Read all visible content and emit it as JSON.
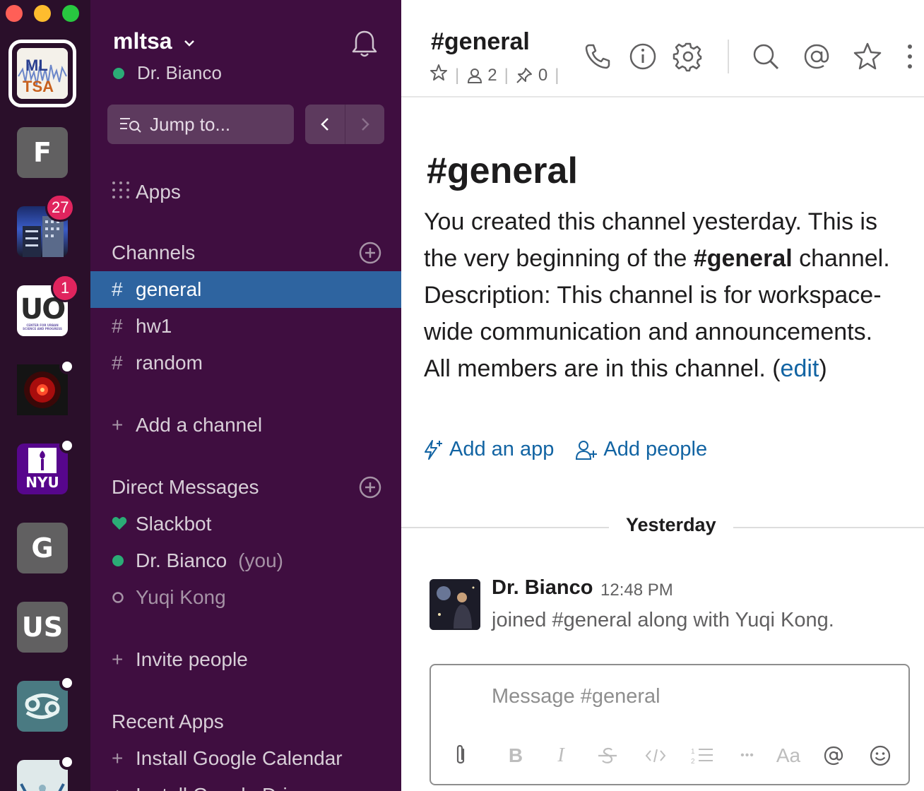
{
  "workspaces": [
    {
      "label": "ML TSA"
    },
    {
      "label": "F"
    },
    {
      "label": "",
      "badge": "27"
    },
    {
      "label": "UO",
      "badge": "1",
      "sublabel": "CENTER FOR URBAN SCIENCE AND PROGRESS"
    },
    {
      "label": ""
    },
    {
      "label": "NYU"
    },
    {
      "label": "G"
    },
    {
      "label": "US"
    },
    {
      "label": ""
    },
    {
      "label": ""
    }
  ],
  "sidebar": {
    "team_name": "mltsa",
    "user_name": "Dr. Bianco",
    "jump_to": "Jump to...",
    "apps_label": "Apps",
    "channels_title": "Channels",
    "channels": [
      {
        "prefix": "#",
        "name": "general",
        "active": true
      },
      {
        "prefix": "#",
        "name": "hw1"
      },
      {
        "prefix": "#",
        "name": "random"
      }
    ],
    "add_channel": "Add a channel",
    "dm_title": "Direct Messages",
    "dms": [
      {
        "name": "Slackbot"
      },
      {
        "name": "Dr. Bianco",
        "suffix": "(you)"
      },
      {
        "name": "Yuqi Kong"
      }
    ],
    "invite_people": "Invite people",
    "recent_apps_title": "Recent Apps",
    "recent_apps": [
      "Install Google Calendar",
      "Install Google Drive"
    ],
    "plus": "+"
  },
  "header": {
    "channel_title": "#general",
    "members_count": "2",
    "pins_count": "0",
    "sep": "|"
  },
  "intro": {
    "title": "#general",
    "text_1": "You created this channel yesterday. This is the very beginning of the ",
    "text_bold": "#general",
    "text_2": " channel. Description: This channel is for workspace-wide communication and announcements. All members are in this channel. (",
    "edit_link": "edit",
    "text_3": ")",
    "add_app": "Add an app",
    "add_people": "Add people"
  },
  "day_divider": "Yesterday",
  "message": {
    "author": "Dr. Bianco",
    "time": "12:48 PM",
    "text": "joined #general along with Yuqi Kong."
  },
  "composer": {
    "placeholder": "Message #general",
    "bold": "B",
    "italic": "I",
    "aa": "Aa",
    "more": "•••"
  },
  "colors": {
    "sidebar_bg": "#3f0e40",
    "rail_bg": "#2a0f2a",
    "active_channel": "#2e64a0",
    "link": "#1264a3",
    "presence": "#2bac76",
    "badge": "#e0245e"
  }
}
